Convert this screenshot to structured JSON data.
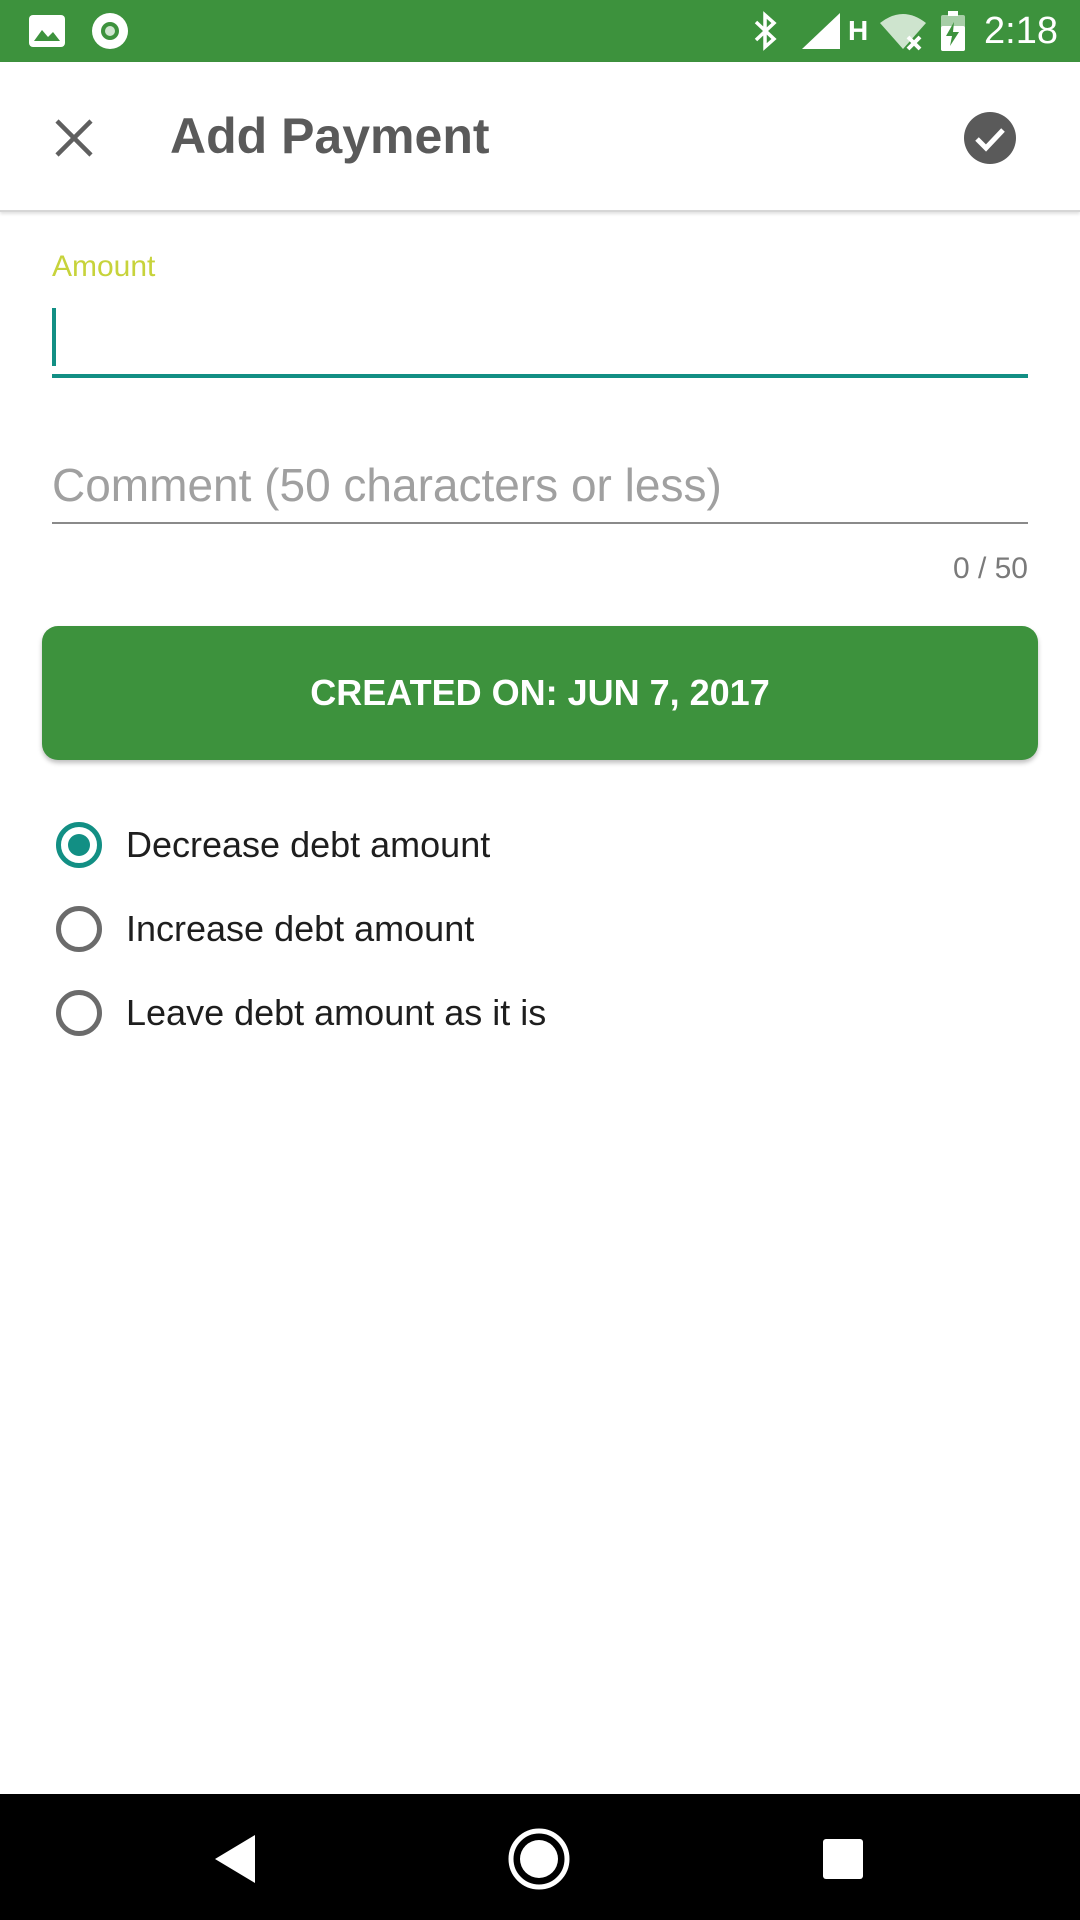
{
  "status_bar": {
    "time": "2:18",
    "icons": [
      "image-icon",
      "circle-app-icon",
      "bluetooth-icon",
      "cell-signal-icon",
      "h-network-icon",
      "wifi-off-icon",
      "battery-charging-icon"
    ],
    "network_letter": "H",
    "background": "#3d923d"
  },
  "app_bar": {
    "title": "Add Payment",
    "close_icon": "close-icon",
    "confirm_icon": "check-circle-icon"
  },
  "form": {
    "amount_label": "Amount",
    "amount_value": "",
    "comment_placeholder": "Comment (50 characters or less)",
    "comment_value": "",
    "comment_counter": "0 / 50"
  },
  "date_button": {
    "label": "CREATED ON: JUN 7, 2017"
  },
  "debt_options": [
    {
      "label": "Decrease debt amount",
      "selected": true
    },
    {
      "label": "Increase debt amount",
      "selected": false
    },
    {
      "label": "Leave debt amount as it is",
      "selected": false
    }
  ],
  "nav_bar": {
    "buttons": [
      "back-icon",
      "home-icon",
      "recents-icon"
    ]
  },
  "colors": {
    "primary_green": "#3d923d",
    "accent_teal": "#128f84",
    "label_lime": "#c7d33b"
  }
}
